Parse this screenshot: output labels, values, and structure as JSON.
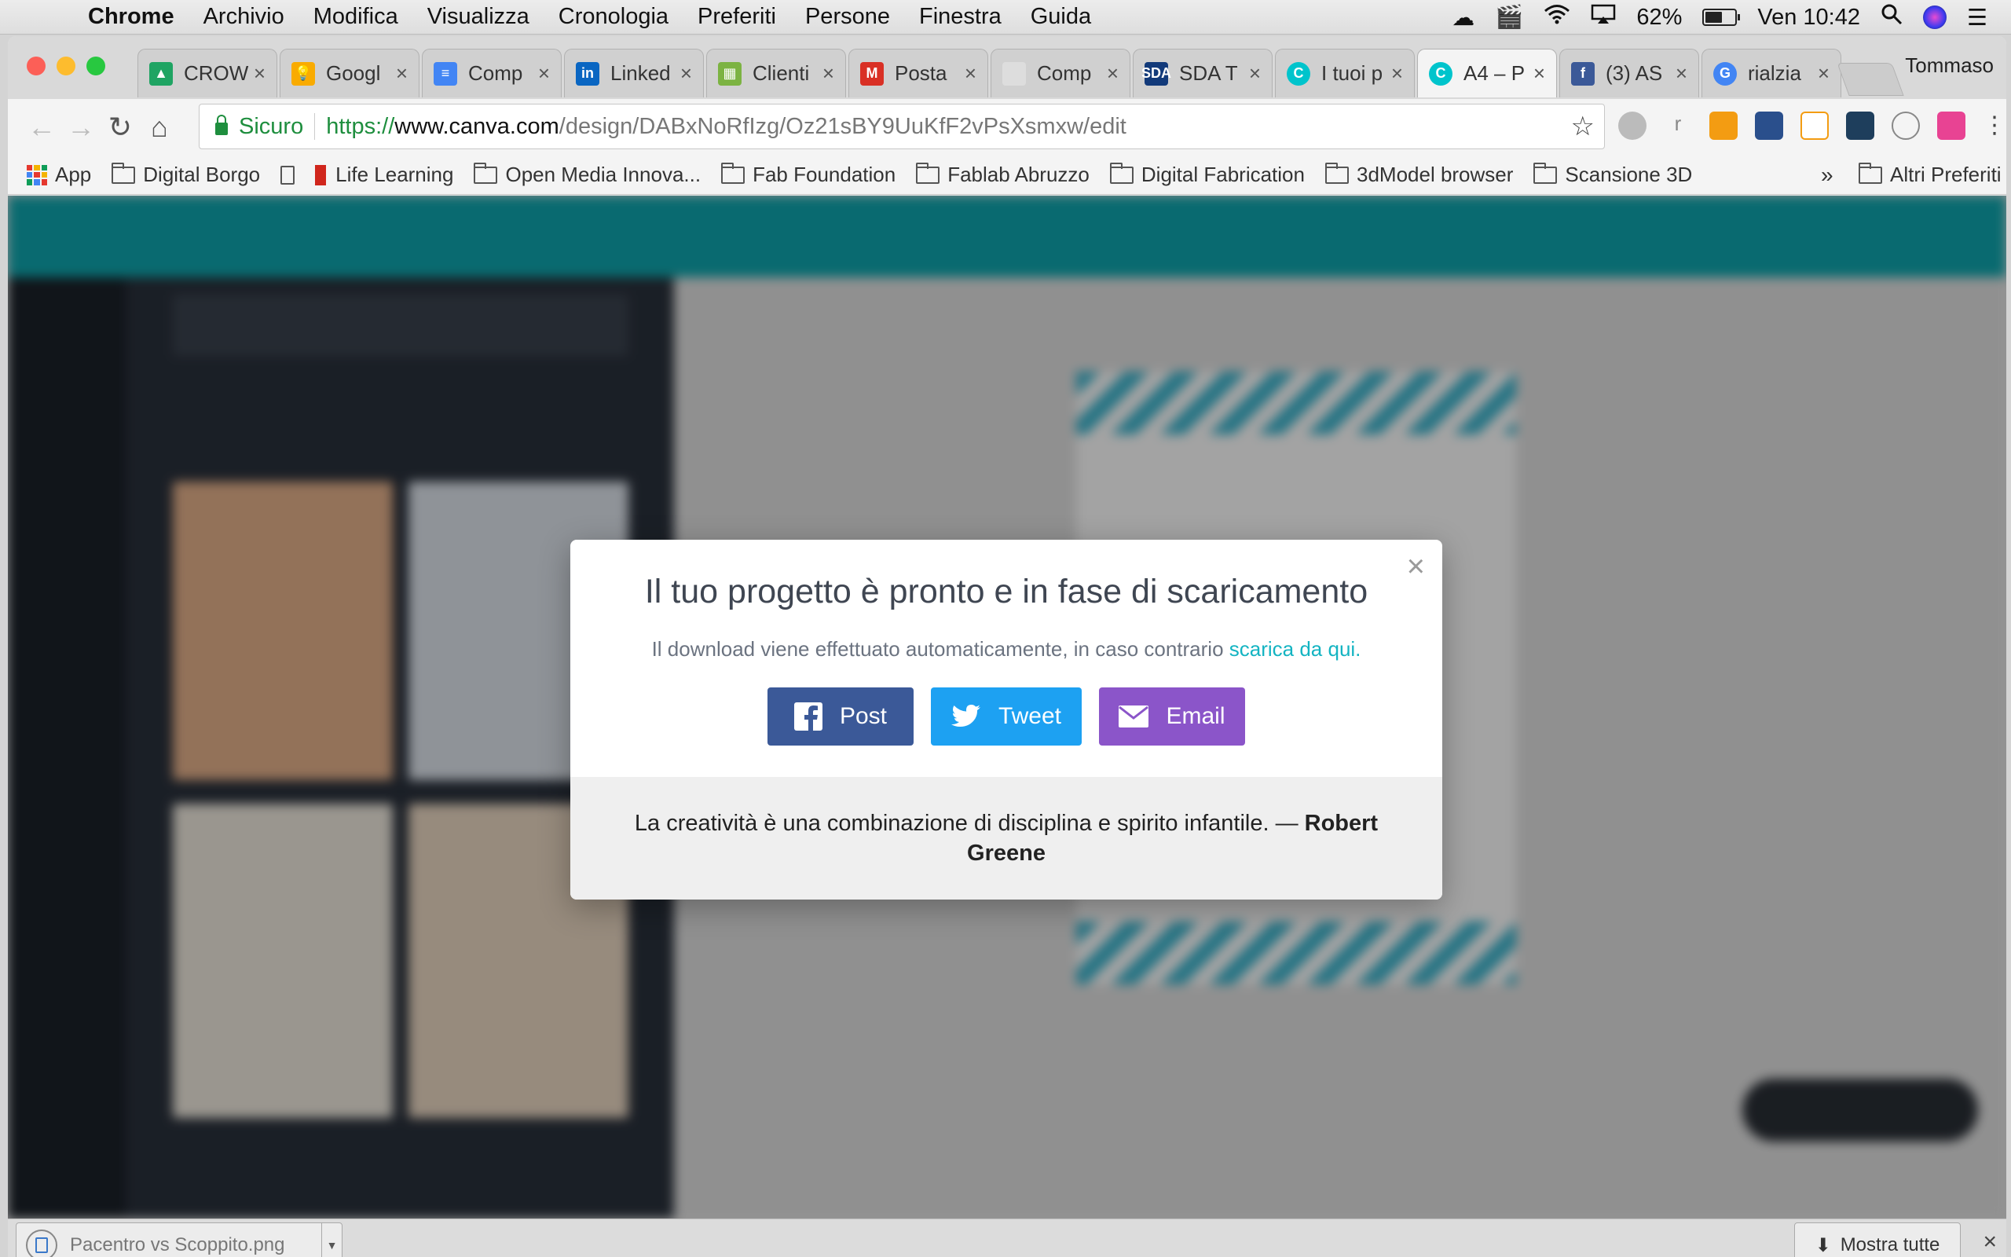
{
  "menubar": {
    "items": [
      "Chrome",
      "Archivio",
      "Modifica",
      "Visualizza",
      "Cronologia",
      "Preferiti",
      "Persone",
      "Finestra",
      "Guida"
    ],
    "battery_percent": "62%",
    "battery_level": 0.62,
    "clock": "Ven 10:42"
  },
  "browser": {
    "profile": "Tommaso",
    "tabs": [
      {
        "title": "CROW",
        "icon": "google-drive-icon",
        "color": "#1fa463"
      },
      {
        "title": "Googl",
        "icon": "google-keep-icon",
        "color": "#f9ab00"
      },
      {
        "title": "Comp",
        "icon": "google-docs-icon",
        "color": "#4285f4"
      },
      {
        "title": "Linked",
        "icon": "linkedin-icon",
        "color": "#0a66c2"
      },
      {
        "title": "Clienti",
        "icon": "google-sheets-icon",
        "color": "#7cb342"
      },
      {
        "title": "Posta",
        "icon": "gmail-icon",
        "color": "#d93025"
      },
      {
        "title": "Comp",
        "icon": "blank-page-icon",
        "color": "#dddddd"
      },
      {
        "title": "SDA T",
        "icon": "sda-icon",
        "color": "#123a7a"
      },
      {
        "title": "I tuoi p",
        "icon": "canva-icon",
        "color": "#00c4cc"
      },
      {
        "title": "A4 – P",
        "icon": "canva-icon",
        "color": "#00c4cc"
      },
      {
        "title": "(3) AS",
        "icon": "facebook-icon",
        "color": "#3b5998"
      },
      {
        "title": "rialzia",
        "icon": "google-icon",
        "color": "#4285f4"
      }
    ],
    "active_tab": 9,
    "address": {
      "secure_label": "Sicuro",
      "scheme": "https://",
      "host": "www.canva.com",
      "path": "/design/DABxNoRfIzg/Oz21sBY9UuKfF2vPsXsmxw/edit"
    },
    "bookmarks": [
      {
        "label": "App",
        "icon": "apps-grid-icon"
      },
      {
        "label": "Digital Borgo",
        "icon": "folder-icon"
      },
      {
        "label": "",
        "icon": "page-icon"
      },
      {
        "label": "Life Learning",
        "icon": "red-bookmark-icon"
      },
      {
        "label": "Open Media Innova...",
        "icon": "folder-icon"
      },
      {
        "label": "Fab Foundation",
        "icon": "folder-icon"
      },
      {
        "label": "Fablab Abruzzo",
        "icon": "folder-icon"
      },
      {
        "label": "Digital Fabrication",
        "icon": "folder-icon"
      },
      {
        "label": "3dModel browser",
        "icon": "folder-icon"
      },
      {
        "label": "Scansione 3D",
        "icon": "folder-icon"
      }
    ],
    "bookmarks_overflow": "»",
    "other_bookmarks": "Altri Preferiti"
  },
  "modal": {
    "close": "×",
    "title": "Il tuo progetto è pronto e in fase di scaricamento",
    "subtitle": "Il download viene effettuato automaticamente, in caso contrario ",
    "subtitle_link": "scarica da qui.",
    "buttons": {
      "post": "Post",
      "tweet": "Tweet",
      "email": "Email"
    },
    "quote": "La creatività è una combinazione di disciplina e spirito infantile. — ",
    "quote_author": "Robert Greene"
  },
  "downloads": {
    "file": "Pacentro vs Scoppito.png",
    "show_all": "Mostra tutte",
    "close": "×"
  },
  "colors": {
    "canva_teal": "#0fa7af",
    "facebook": "#3b5998",
    "twitter": "#1da1f2",
    "email": "#8b55c9",
    "link": "#14b4c2"
  }
}
